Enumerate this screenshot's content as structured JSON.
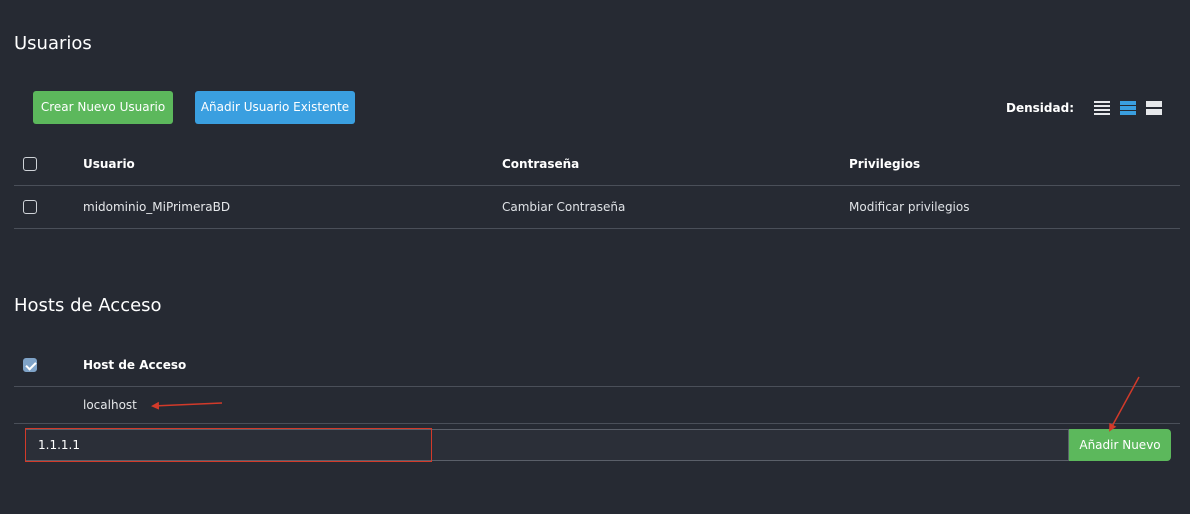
{
  "users": {
    "title": "Usuarios",
    "buttons": {
      "create": "Crear Nuevo Usuario",
      "add_existing": "Añadir Usuario Existente"
    },
    "density": {
      "label": "Densidad:",
      "options": [
        "compact-icon",
        "medium-icon",
        "comfortable-icon"
      ],
      "active": "medium"
    },
    "table": {
      "headers": [
        "Usuario",
        "Contraseña",
        "Privilegios"
      ],
      "rows": [
        {
          "user": "midominio_MiPrimeraBD",
          "password_action": "Cambiar Contraseña",
          "privileges_action": "Modificar privilegios"
        }
      ]
    }
  },
  "hosts": {
    "title": "Hosts de Acceso",
    "header": "Host de Acceso",
    "rows": [
      "localhost"
    ],
    "input_value": "1.1.1.1",
    "add_button": "Añadir Nuevo"
  },
  "colors": {
    "background": "#262a33",
    "green": "#5cb85c",
    "blue": "#3a9fe0",
    "annotation_red": "#d23a2a"
  }
}
